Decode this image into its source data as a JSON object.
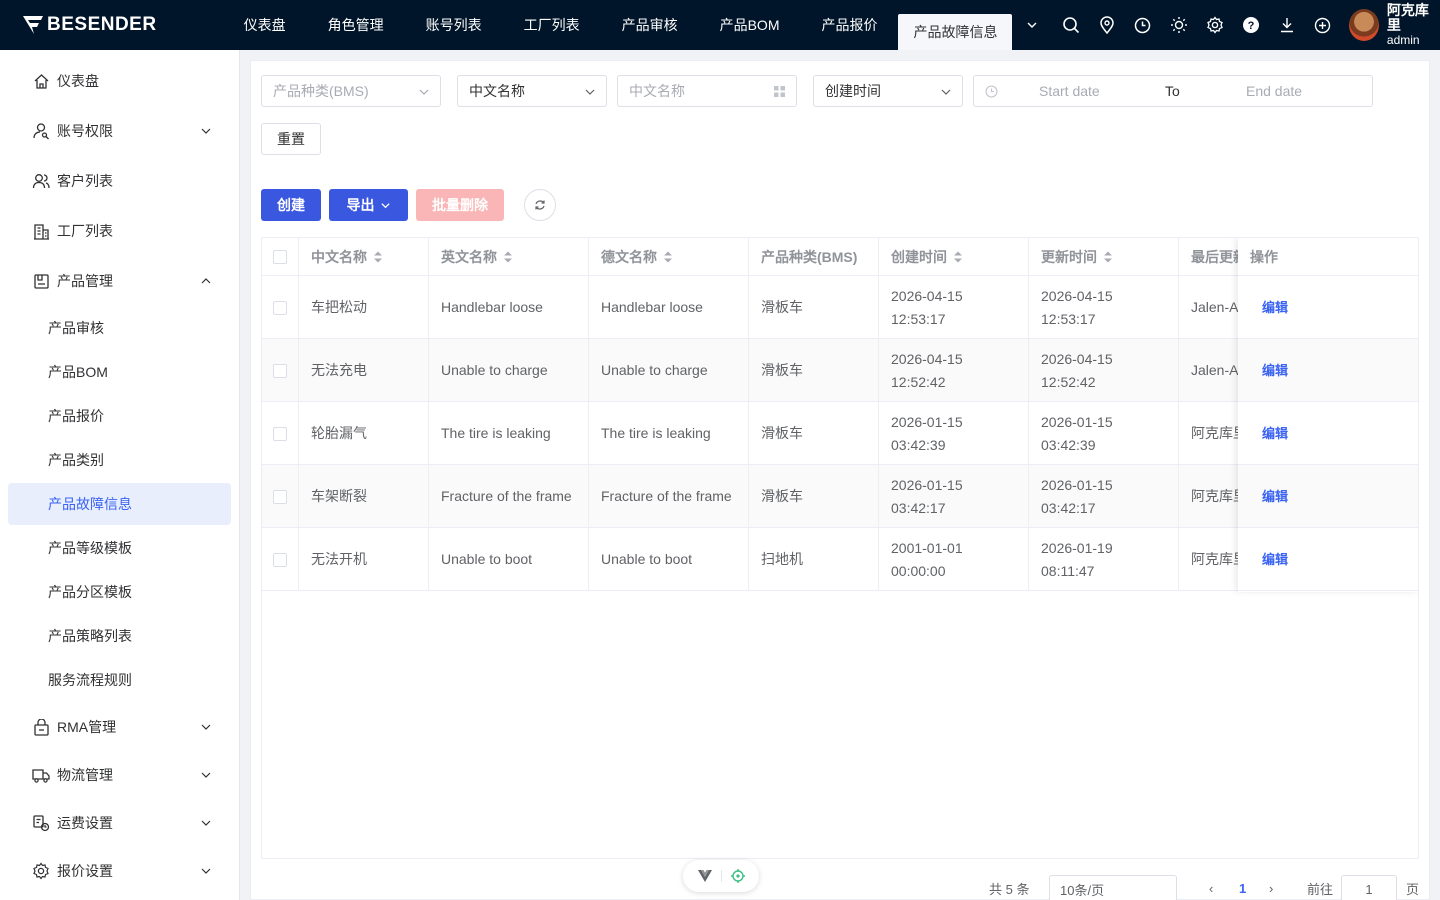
{
  "brand": {
    "name": "BESENDER"
  },
  "top_nav": {
    "items": [
      "仪表盘",
      "角色管理",
      "账号列表",
      "工厂列表",
      "产品审核",
      "产品BOM",
      "产品报价",
      "产品故障信息"
    ],
    "active_index": 7
  },
  "top_icons": [
    "search-icon",
    "location-icon",
    "clock-icon",
    "sun-icon",
    "gear-icon",
    "help-icon",
    "download-icon",
    "plus-circle-icon"
  ],
  "user": {
    "name": "阿克库里",
    "role": "admin"
  },
  "sidebar": {
    "items": [
      {
        "label": "仪表盘",
        "icon": "home-icon"
      },
      {
        "label": "账号权限",
        "icon": "user-key-icon"
      },
      {
        "label": "客户列表",
        "icon": "users-icon"
      },
      {
        "label": "工厂列表",
        "icon": "building-icon"
      },
      {
        "label": "产品管理",
        "icon": "box-icon"
      },
      {
        "label": "RMA管理",
        "icon": "rma-icon"
      },
      {
        "label": "物流管理",
        "icon": "truck-icon"
      },
      {
        "label": "运费设置",
        "icon": "freight-icon"
      },
      {
        "label": "报价设置",
        "icon": "gear-icon"
      }
    ],
    "sub_items": [
      "产品审核",
      "产品BOM",
      "产品报价",
      "产品类别",
      "产品故障信息",
      "产品等级模板",
      "产品分区模板",
      "产品策略列表",
      "服务流程规则"
    ],
    "active_sub_index": 4
  },
  "filters": {
    "product_type_placeholder": "产品种类(BMS)",
    "name_select_value": "中文名称",
    "name_input_placeholder": "中文名称",
    "time_select_value": "创建时间",
    "start_placeholder": "Start date",
    "range_separator": "To",
    "end_placeholder": "End date",
    "reset_label": "重置"
  },
  "toolbar": {
    "create_label": "创建",
    "export_label": "导出",
    "batch_delete_label": "批量删除"
  },
  "table": {
    "columns": [
      "中文名称",
      "英文名称",
      "德文名称",
      "产品种类(BMS)",
      "创建时间",
      "更新时间",
      "最后更新",
      "操作"
    ],
    "rows": [
      {
        "cn": "车把松动",
        "en": "Handlebar loose",
        "de": "Handlebar loose",
        "type": "滑板车",
        "created_date": "2026-04-15",
        "created_time": "12:53:17",
        "updated_date": "2026-04-15",
        "updated_time": "12:53:17",
        "last": "Jalen-A",
        "action": "编辑"
      },
      {
        "cn": "无法充电",
        "en": "Unable to charge",
        "de": "Unable to charge",
        "type": "滑板车",
        "created_date": "2026-04-15",
        "created_time": "12:52:42",
        "updated_date": "2026-04-15",
        "updated_time": "12:52:42",
        "last": "Jalen-A",
        "action": "编辑"
      },
      {
        "cn": "轮胎漏气",
        "en": "The tire is leaking",
        "de": "The tire is leaking",
        "type": "滑板车",
        "created_date": "2026-01-15",
        "created_time": "03:42:39",
        "updated_date": "2026-01-15",
        "updated_time": "03:42:39",
        "last": "阿克库里",
        "action": "编辑"
      },
      {
        "cn": "车架断裂",
        "en": "Fracture of the frame",
        "de": "Fracture of the frame",
        "type": "滑板车",
        "created_date": "2026-01-15",
        "created_time": "03:42:17",
        "updated_date": "2026-01-15",
        "updated_time": "03:42:17",
        "last": "阿克库里",
        "action": "编辑"
      },
      {
        "cn": "无法开机",
        "en": "Unable to boot",
        "de": "Unable to boot",
        "type": "扫地机",
        "created_date": "2001-01-01",
        "created_time": "00:00:00",
        "updated_date": "2026-01-19",
        "updated_time": "08:11:47",
        "last": "阿克库里",
        "action": "编辑"
      }
    ]
  },
  "pagination": {
    "total_text": "共 5 条",
    "page_size": "10条/页",
    "current_page": "1",
    "goto_label": "前往",
    "goto_value": "1",
    "page_suffix": "页"
  }
}
